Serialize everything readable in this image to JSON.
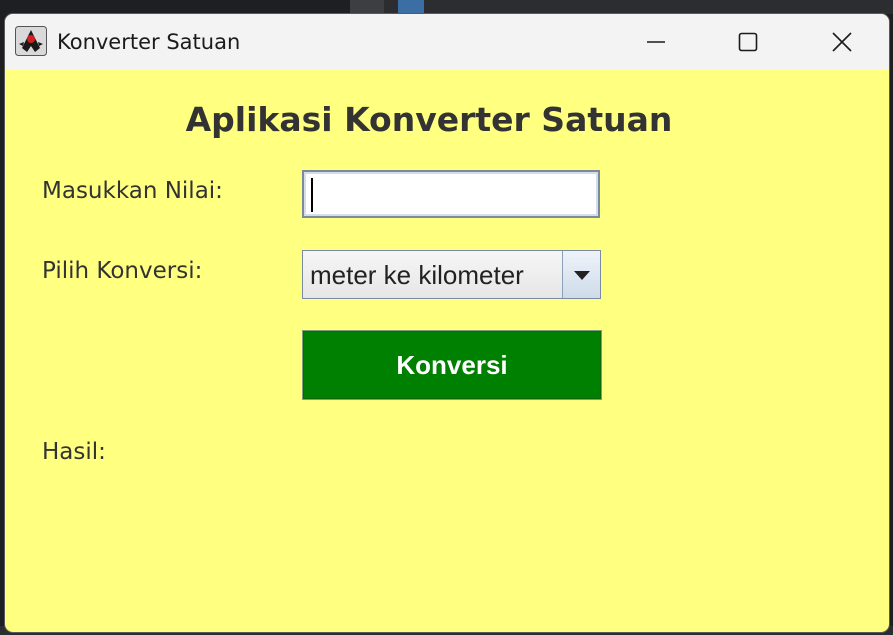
{
  "window": {
    "title": "Konverter Satuan",
    "icon": "java-duke-icon",
    "controls": [
      "minimize-icon",
      "maximize-icon",
      "close-icon"
    ]
  },
  "form": {
    "heading": "Aplikasi Konverter Satuan",
    "value_label": "Masukkan Nilai:",
    "value_input": "",
    "conversion_label": "Pilih Konversi:",
    "conversion_selected": "meter ke kilometer",
    "convert_button": "Konversi",
    "result_label": "Hasil:",
    "result_value": ""
  },
  "colors": {
    "background": "#ffff80",
    "button": "#008000",
    "button_text": "#ffffff",
    "text": "#333333"
  }
}
